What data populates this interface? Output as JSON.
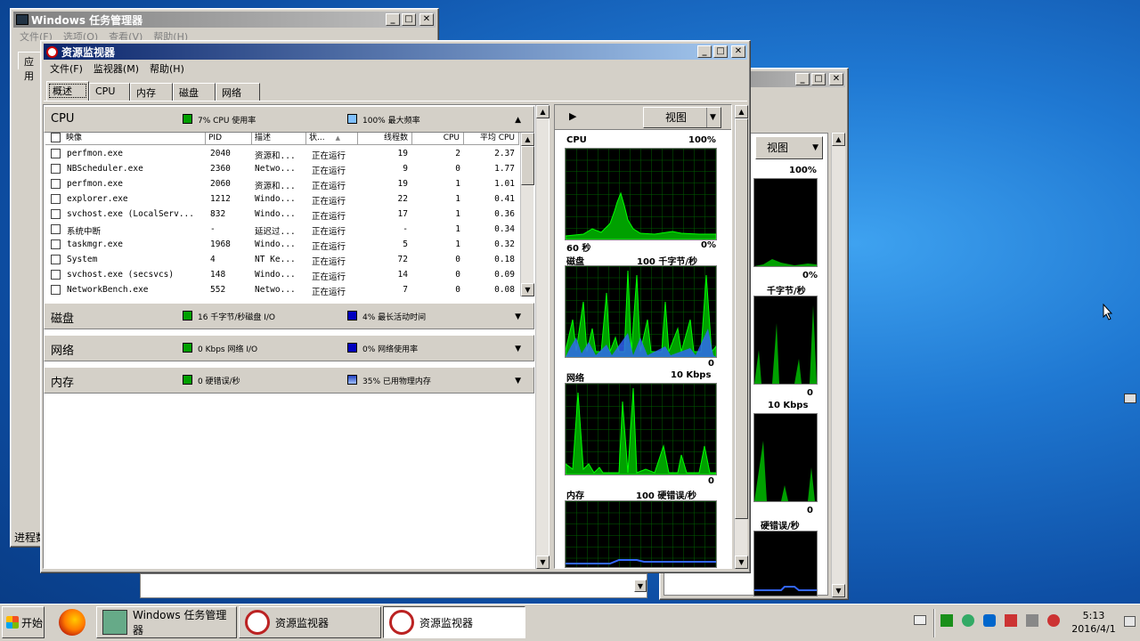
{
  "taskmgr": {
    "title": "Windows 任务管理器",
    "menu": [
      "文件(F)",
      "选项(O)",
      "查看(V)",
      "帮助(H)"
    ],
    "tab_partial": "应用",
    "status_partial": "进程数"
  },
  "resmon_back": {
    "view_label": "视图",
    "graphs": [
      {
        "top": "100%",
        "bottom": "0%"
      },
      {
        "top": "千字节/秒",
        "bottom": "0"
      },
      {
        "top": "10 Kbps",
        "bottom": "0"
      },
      {
        "top": "硬错误/秒",
        "bottom": ""
      }
    ]
  },
  "resmon": {
    "title": "资源监视器",
    "menu": [
      "文件(F)",
      "监视器(M)",
      "帮助(H)"
    ],
    "tabs": [
      "概述",
      "CPU",
      "内存",
      "磁盘",
      "网络"
    ],
    "cpu_section": {
      "name": "CPU",
      "legend1": "7% CPU 使用率",
      "legend2": "100% 最大频率",
      "columns": [
        "映像",
        "PID",
        "描述",
        "状...",
        "线程数",
        "CPU",
        "平均 CPU"
      ],
      "rows": [
        [
          "perfmon.exe",
          "2040",
          "资源和...",
          "正在运行",
          "19",
          "2",
          "2.37"
        ],
        [
          "NBScheduler.exe",
          "2360",
          "Netwo...",
          "正在运行",
          "9",
          "0",
          "1.77"
        ],
        [
          "perfmon.exe",
          "2060",
          "资源和...",
          "正在运行",
          "19",
          "1",
          "1.01"
        ],
        [
          "explorer.exe",
          "1212",
          "Windo...",
          "正在运行",
          "22",
          "1",
          "0.41"
        ],
        [
          "svchost.exe (LocalServ...",
          "832",
          "Windo...",
          "正在运行",
          "17",
          "1",
          "0.36"
        ],
        [
          "系统中断",
          "-",
          "延迟过...",
          "正在运行",
          "-",
          "1",
          "0.34"
        ],
        [
          "taskmgr.exe",
          "1968",
          "Windo...",
          "正在运行",
          "5",
          "1",
          "0.32"
        ],
        [
          "System",
          "4",
          "NT Ke...",
          "正在运行",
          "72",
          "0",
          "0.18"
        ],
        [
          "svchost.exe (secsvcs)",
          "148",
          "Windo...",
          "正在运行",
          "14",
          "0",
          "0.09"
        ],
        [
          "NetworkBench.exe",
          "552",
          "Netwo...",
          "正在运行",
          "7",
          "0",
          "0.08"
        ]
      ]
    },
    "disk_section": {
      "name": "磁盘",
      "legend1": "16 千字节/秒磁盘 I/O",
      "legend2": "4% 最长活动时间"
    },
    "net_section": {
      "name": "网络",
      "legend1": "0 Kbps 网络 I/O",
      "legend2": "0% 网络使用率"
    },
    "mem_section": {
      "name": "内存",
      "legend1": "0 硬错误/秒",
      "legend2": "35% 已用物理内存"
    },
    "view_label": "视图",
    "graphs": [
      {
        "name": "CPU",
        "max": "100%",
        "footer_left": "60 秒",
        "footer_right": "0%"
      },
      {
        "name": "磁盘",
        "max": "100 千字节/秒",
        "footer_right": "0"
      },
      {
        "name": "网络",
        "max": "10 Kbps",
        "footer_right": "0"
      },
      {
        "name": "内存",
        "max": "100 硬错误/秒"
      }
    ]
  },
  "taskbar": {
    "start_label": "开始",
    "buttons": [
      "Windows 任务管理器",
      "资源监视器",
      "资源监视器"
    ],
    "clock_time": "5:13",
    "clock_date": "2016/4/1"
  },
  "colors": {
    "graph_green": "#00c000",
    "graph_blue": "#3366ff",
    "title_active": "#0a246a"
  }
}
